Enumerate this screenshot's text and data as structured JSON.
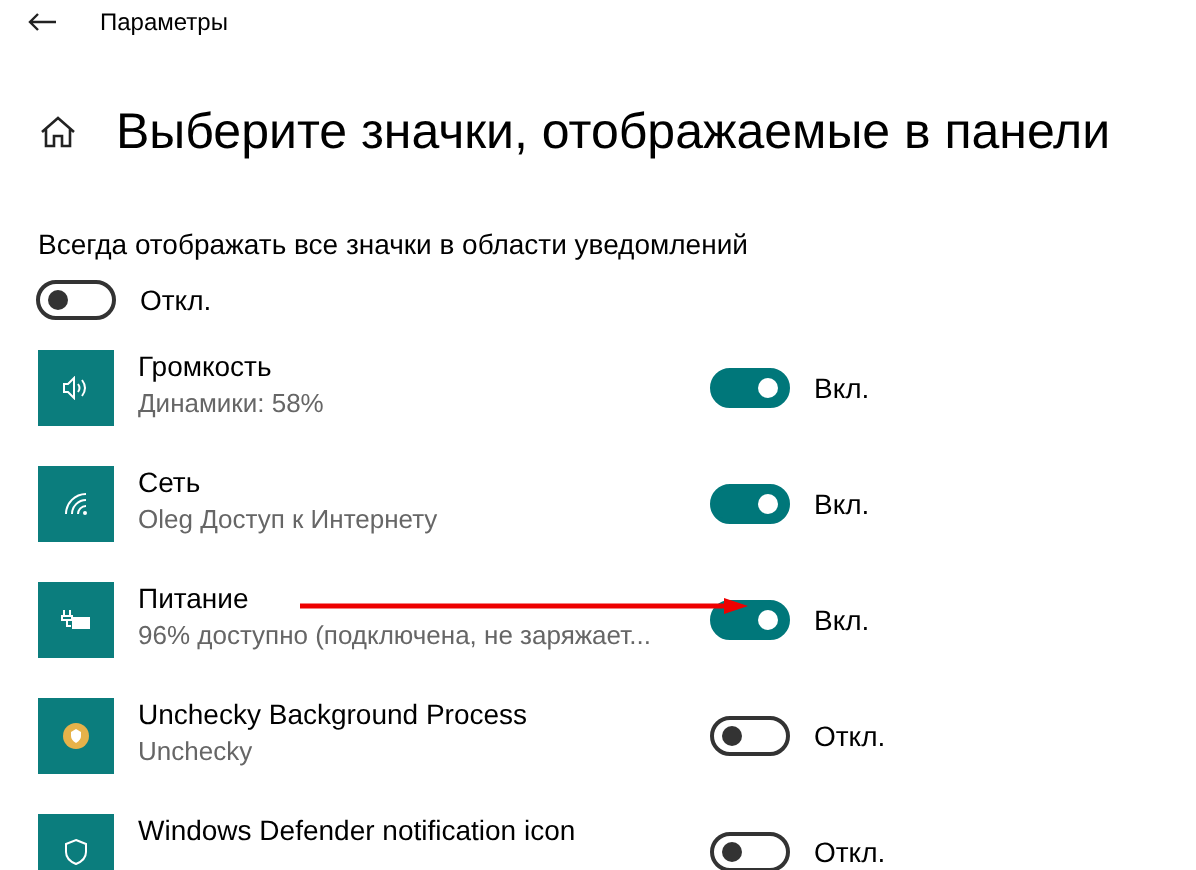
{
  "window": {
    "title": "Параметры"
  },
  "heading": "Выберите значки, отображаемые в панели",
  "always_show": {
    "label": "Всегда отображать все значки в области уведомлений",
    "on": false,
    "state_text": "Откл."
  },
  "items": [
    {
      "kind": "volume",
      "name": "Громкость",
      "detail": "Динамики: 58%",
      "on": true,
      "state_text": "Вкл."
    },
    {
      "kind": "network",
      "name": "Сеть",
      "detail": "Oleg Доступ к Интернету",
      "on": true,
      "state_text": "Вкл."
    },
    {
      "kind": "power",
      "name": "Питание",
      "detail": "96% доступно (подключена, не заряжает...",
      "on": true,
      "state_text": "Вкл.",
      "annotated": true
    },
    {
      "kind": "unchecky",
      "name": "Unchecky Background Process",
      "detail": "Unchecky",
      "on": false,
      "state_text": "Откл."
    },
    {
      "kind": "defender",
      "name": "Windows Defender notification icon",
      "on": false,
      "state_text": "Откл."
    }
  ]
}
